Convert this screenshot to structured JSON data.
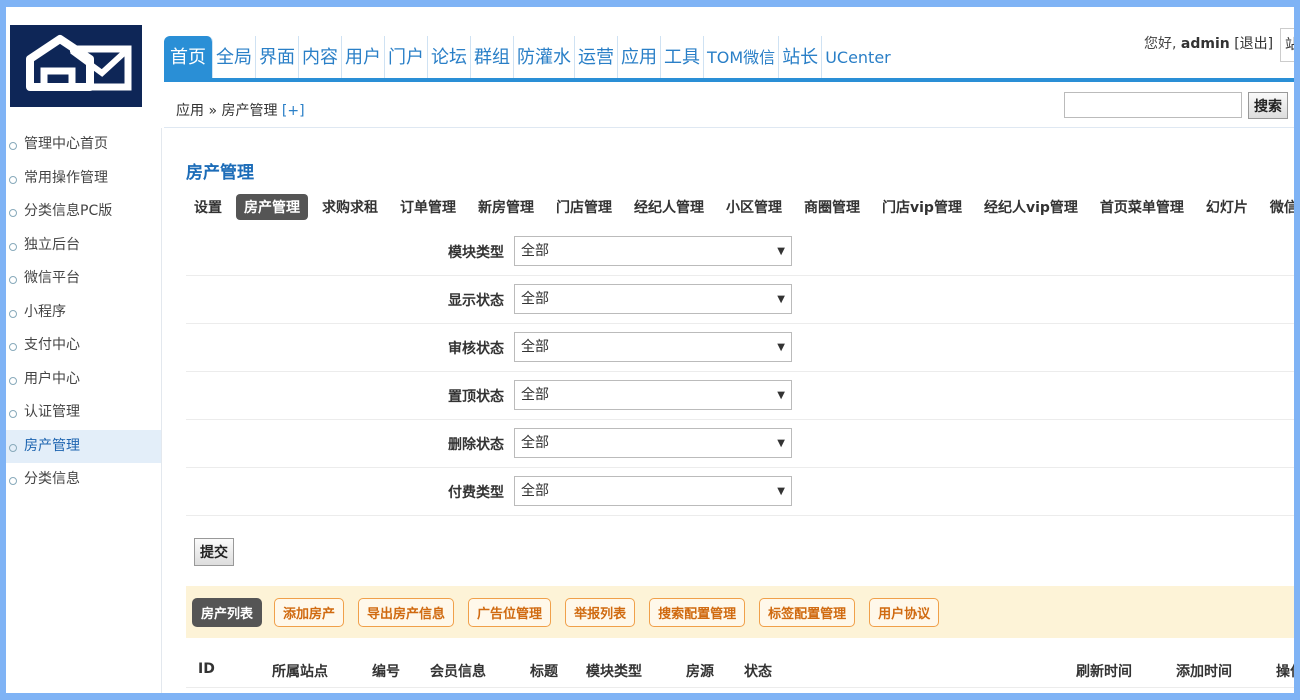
{
  "header": {
    "nav": [
      {
        "label": "首页",
        "active": true
      },
      {
        "label": "全局"
      },
      {
        "label": "界面"
      },
      {
        "label": "内容"
      },
      {
        "label": "用户"
      },
      {
        "label": "门户"
      },
      {
        "label": "论坛"
      },
      {
        "label": "群组"
      },
      {
        "label": "防灌水"
      },
      {
        "label": "运营"
      },
      {
        "label": "应用"
      },
      {
        "label": "工具"
      },
      {
        "label": "TOM微信"
      },
      {
        "label": "站长"
      },
      {
        "label": "UCenter"
      }
    ],
    "greeting": "您好,",
    "username": "admin",
    "logout": "[退出]",
    "corner_text": "站"
  },
  "breadcrumb": {
    "text": "应用 » 房产管理",
    "plus": "[+]"
  },
  "search": {
    "button": "搜索",
    "value": ""
  },
  "sidebar": {
    "items": [
      {
        "label": "管理中心首页"
      },
      {
        "label": "常用操作管理"
      },
      {
        "label": "分类信息PC版"
      },
      {
        "label": "独立后台"
      },
      {
        "label": "微信平台"
      },
      {
        "label": "小程序"
      },
      {
        "label": "支付中心"
      },
      {
        "label": "用户中心"
      },
      {
        "label": "认证管理"
      },
      {
        "label": "房产管理",
        "active": true
      },
      {
        "label": "分类信息"
      }
    ]
  },
  "main": {
    "title": "房产管理",
    "tabs": [
      {
        "label": "设置"
      },
      {
        "label": "房产管理",
        "active": true
      },
      {
        "label": "求购求租"
      },
      {
        "label": "订单管理"
      },
      {
        "label": "新房管理"
      },
      {
        "label": "门店管理"
      },
      {
        "label": "经纪人管理"
      },
      {
        "label": "小区管理"
      },
      {
        "label": "商圈管理"
      },
      {
        "label": "门店vip管理"
      },
      {
        "label": "经纪人vip管理"
      },
      {
        "label": "首页菜单管理"
      },
      {
        "label": "幻灯片"
      },
      {
        "label": "微信营销专区"
      }
    ],
    "filters": [
      {
        "label": "模块类型",
        "value": "全部"
      },
      {
        "label": "显示状态",
        "value": "全部"
      },
      {
        "label": "审核状态",
        "value": "全部"
      },
      {
        "label": "置顶状态",
        "value": "全部"
      },
      {
        "label": "删除状态",
        "value": "全部"
      },
      {
        "label": "付费类型",
        "value": "全部"
      }
    ],
    "submit": "提交",
    "actions": [
      {
        "label": "房产列表",
        "dark": true
      },
      {
        "label": "添加房产"
      },
      {
        "label": "导出房产信息"
      },
      {
        "label": "广告位管理"
      },
      {
        "label": "举报列表"
      },
      {
        "label": "搜索配置管理"
      },
      {
        "label": "标签配置管理"
      },
      {
        "label": "用户协议"
      }
    ],
    "columns": [
      "ID",
      "所属站点",
      "编号",
      "会员信息",
      "标题",
      "模块类型",
      "房源",
      "状态",
      "刷新时间",
      "添加时间",
      "操作"
    ]
  },
  "colors": {
    "accent": "#2a8fd6",
    "link": "#2a7fc7",
    "logo_bg": "#0e2657",
    "action_bar": "#fdf3d7",
    "action_text": "#d06a10"
  }
}
